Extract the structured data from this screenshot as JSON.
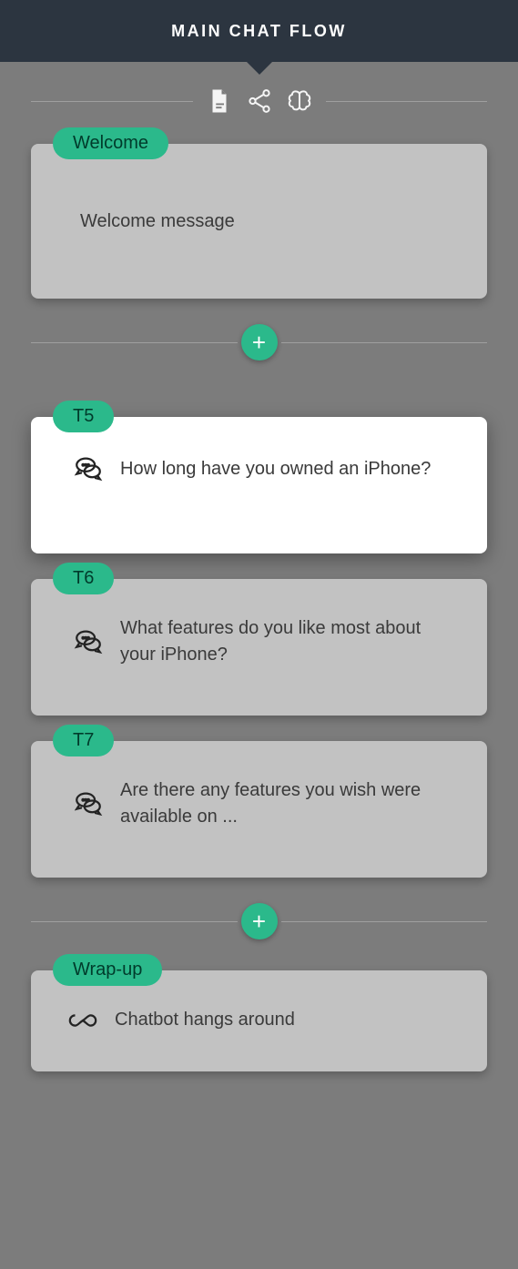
{
  "header": {
    "title": "MAIN CHAT FLOW"
  },
  "cards": {
    "welcome": {
      "tag": "Welcome",
      "text": "Welcome message"
    },
    "t5": {
      "tag": "T5",
      "text": "How long have you owned an iPhone?"
    },
    "t6": {
      "tag": "T6",
      "text": "What features do you like most about your iPhone?"
    },
    "t7": {
      "tag": "T7",
      "text": "Are there any features you wish were available on ..."
    },
    "wrapup": {
      "tag": "Wrap-up",
      "text": "Chatbot hangs around"
    }
  },
  "plus": "+"
}
